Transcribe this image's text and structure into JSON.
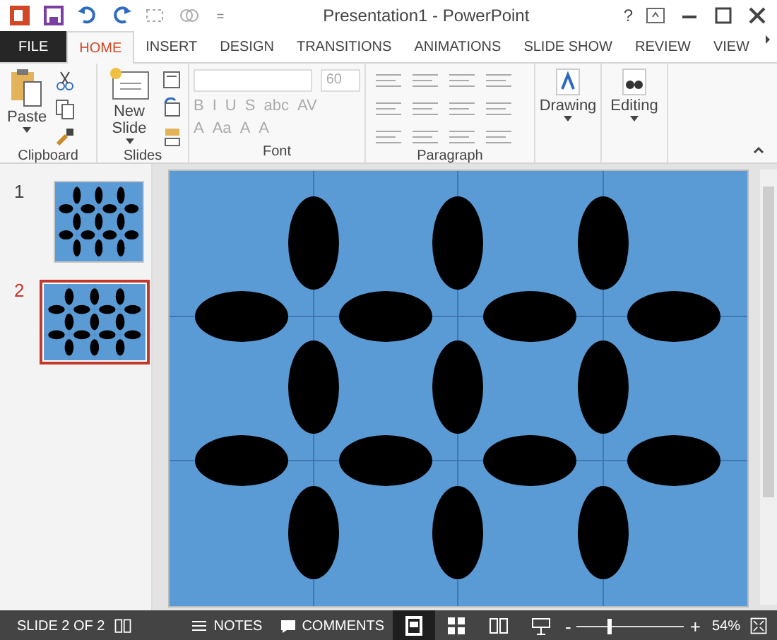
{
  "window": {
    "title": "Presentation1 - PowerPoint",
    "help": "?"
  },
  "tabs": [
    {
      "label": "FILE",
      "kind": "file",
      "selected": false
    },
    {
      "label": "HOME",
      "kind": "tab",
      "selected": true
    },
    {
      "label": "INSERT",
      "kind": "tab",
      "selected": false
    },
    {
      "label": "DESIGN",
      "kind": "tab",
      "selected": false
    },
    {
      "label": "TRANSITIONS",
      "kind": "tab",
      "selected": false
    },
    {
      "label": "ANIMATIONS",
      "kind": "tab",
      "selected": false
    },
    {
      "label": "SLIDE SHOW",
      "kind": "tab",
      "selected": false
    },
    {
      "label": "REVIEW",
      "kind": "tab",
      "selected": false
    },
    {
      "label": "VIEW",
      "kind": "tab",
      "selected": false
    }
  ],
  "ribbon": {
    "clipboard": {
      "label": "Clipboard",
      "paste": "Paste"
    },
    "slides": {
      "label": "Slides",
      "new_slide": "New Slide"
    },
    "font": {
      "label": "Font",
      "size": "60",
      "disabled": true,
      "row_1": [
        "B",
        "I",
        "U",
        "S",
        "abc",
        "AV"
      ],
      "row_2": [
        "A",
        "Aa",
        "A",
        "A"
      ]
    },
    "paragraph": {
      "label": "Paragraph"
    },
    "drawing": {
      "label": "Drawing"
    },
    "editing": {
      "label": "Editing"
    }
  },
  "slides": [
    {
      "number": "1",
      "selected": false
    },
    {
      "number": "2",
      "selected": true
    }
  ],
  "status_bar": {
    "slide": "SLIDE 2 OF 2",
    "notes": "NOTES",
    "comments": "COMMENTS",
    "views": [
      {
        "kind": "normal",
        "selected": true
      },
      {
        "kind": "sorter",
        "selected": false
      },
      {
        "kind": "reading",
        "selected": false
      },
      {
        "kind": "show",
        "selected": false
      }
    ],
    "zoom_out": "-",
    "zoom_in": "+",
    "zoom": {
      "level": 0.28
    },
    "zoom_reading": "54%"
  }
}
